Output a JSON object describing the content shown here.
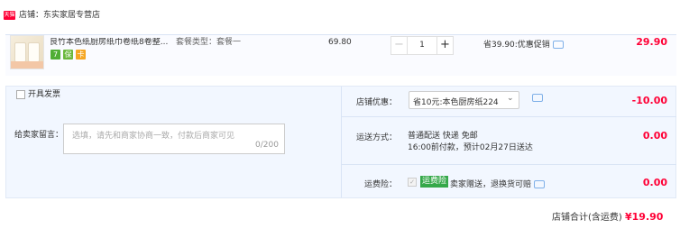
{
  "store": {
    "badge": "天猫",
    "label": "店铺：东实家居专营店"
  },
  "item": {
    "title": "良竹本色纸厨房纸巾卷纸8卷整...",
    "spec": "套餐类型：套餐一",
    "unit_price": "69.80",
    "quantity": "1",
    "minus": "−",
    "plus": "+",
    "saving": "省39.90:优惠促销",
    "subtotal": "29.90",
    "icons": [
      "7",
      "保",
      "卡"
    ]
  },
  "options": {
    "invoice_label": "开具发票",
    "memo_label": "给卖家留言：",
    "memo_placeholder": "选填，请先和商家协商一致，付款后商家可见",
    "memo_count": "0/200",
    "store_discount": {
      "label": "店铺优惠：",
      "selected": "省10元:本色厨房纸224",
      "value": "-10.00"
    },
    "shipping": {
      "label": "运送方式：",
      "line1": "普通配送 快递 免邮",
      "line2": "16:00前付款，预计02月27日送达",
      "value": "0.00"
    },
    "insurance": {
      "label": "运费险：",
      "check": "✓",
      "badge": "运费险",
      "text": "卖家赠送，退换货可赔",
      "value": "0.00"
    }
  },
  "footer": {
    "total_label": "店铺合计(含运费)",
    "total_value": "¥19.90"
  },
  "colors": {
    "accent_red": "#ff0036",
    "insurance_green": "#35a84a",
    "panel_bg": "#f2f7ff"
  }
}
